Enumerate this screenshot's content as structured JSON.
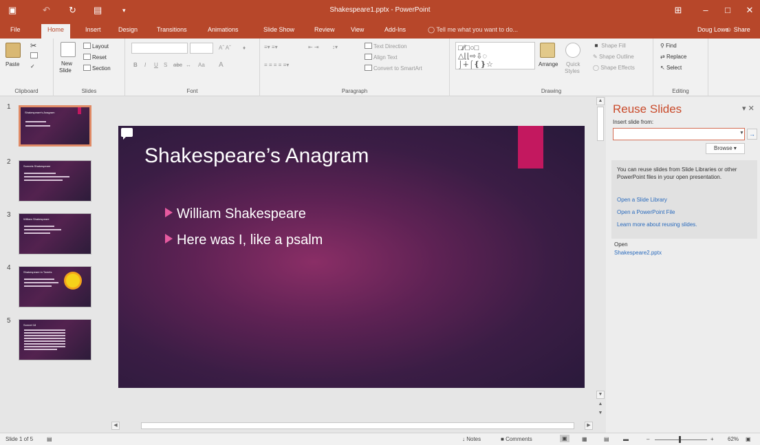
{
  "window": {
    "title": "Shakespeare1.pptx - PowerPoint",
    "buttons": {
      "ribbon_display": "⊞",
      "minimize": "–",
      "maximize": "□",
      "close": "✕"
    }
  },
  "qat": {
    "save_icon": "save-icon",
    "undo_icon": "undo-icon",
    "redo_icon": "redo-icon",
    "start_icon": "present-from-start-icon",
    "customize": "▾"
  },
  "tabs": [
    "File",
    "Home",
    "Insert",
    "Design",
    "Transitions",
    "Animations",
    "Slide Show",
    "Review",
    "View",
    "Add-Ins"
  ],
  "active_tab": "Home",
  "tell_me": "Tell me what you want to do...",
  "user": "Doug Lowe",
  "share": "Share",
  "ribbon": {
    "clipboard": {
      "label": "Clipboard",
      "paste": "Paste"
    },
    "slides": {
      "label": "Slides",
      "new_slide": "New",
      "new_slide_2": "Slide",
      "layout": "Layout",
      "reset": "Reset",
      "section": "Section"
    },
    "font": {
      "label": "Font",
      "bold": "B",
      "italic": "I",
      "underline": "U",
      "strike": "S",
      "abc": "abc",
      "aa": "Aa",
      "a": "A"
    },
    "paragraph": {
      "label": "Paragraph",
      "text_direction": "Text Direction",
      "align_text": "Align Text",
      "convert_smartart": "Convert to SmartArt"
    },
    "drawing": {
      "label": "Drawing",
      "arrange": "Arrange",
      "quick_styles": "Quick",
      "quick_styles_2": "Styles",
      "shape_fill": "Shape Fill",
      "shape_outline": "Shape Outline",
      "shape_effects": "Shape Effects"
    },
    "editing": {
      "label": "Editing",
      "find": "Find",
      "replace": "Replace",
      "select": "Select"
    }
  },
  "thumbnails": [
    {
      "num": "1",
      "title": "Shakespeare's Anagram"
    },
    {
      "num": "2",
      "title": "Sonnets Shakespeare"
    },
    {
      "num": "3",
      "title": "William Shakespeare"
    },
    {
      "num": "4",
      "title": "Shakespeare in Tweets"
    },
    {
      "num": "5",
      "title": "Sonnet 18"
    }
  ],
  "slide": {
    "title": "Shakespeare’s Anagram",
    "bullets": [
      "William Shakespeare",
      "Here was I, like a psalm"
    ]
  },
  "reuse_pane": {
    "title": "Reuse Slides",
    "close": "▾ ✕",
    "insert_from": "Insert slide from:",
    "input_value": "",
    "go": "→",
    "browse": "Browse ▾",
    "info": "You can reuse slides from Slide Libraries or other PowerPoint files in your open presentation.",
    "links": [
      "Open a Slide Library",
      "Open a PowerPoint File",
      "Learn more about reusing slides."
    ],
    "open_label": "Open",
    "open_file": "Shakespeare2.pptx"
  },
  "status": {
    "slide_of": "Slide 1 of 5",
    "notes": "Notes",
    "comments": "Comments",
    "zoom": "62%",
    "zoom_minus": "–",
    "zoom_plus": "+"
  },
  "colors": {
    "accent": "#b7472a",
    "slide_accent": "#c3185f",
    "bullet": "#e65aa0",
    "pane_title": "#c94a2a",
    "link": "#2a6bbd"
  }
}
